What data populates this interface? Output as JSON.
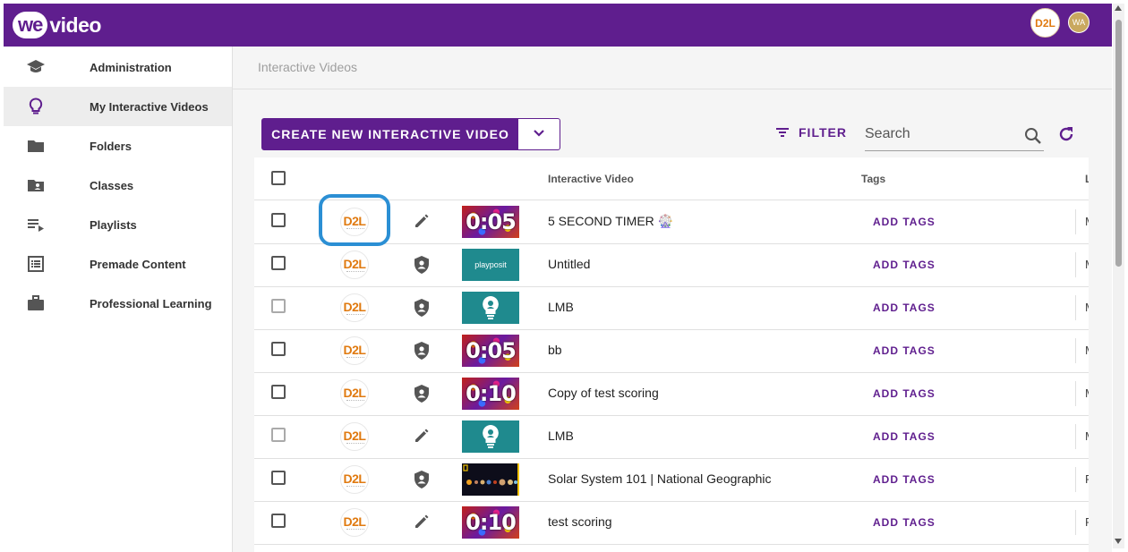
{
  "app": {
    "logo_we": "we",
    "logo_video": "video",
    "org_badge": "D2L",
    "user_initials": "WA",
    "brand_color": "#5f1e8e"
  },
  "sidebar": {
    "items": [
      {
        "label": "Administration",
        "icon": "graduation-cap-icon",
        "active": false
      },
      {
        "label": "My Interactive Videos",
        "icon": "lightbulb-icon",
        "active": true
      },
      {
        "label": "Folders",
        "icon": "folder-icon",
        "active": false
      },
      {
        "label": "Classes",
        "icon": "class-folder-icon",
        "active": false
      },
      {
        "label": "Playlists",
        "icon": "playlist-icon",
        "active": false
      },
      {
        "label": "Premade Content",
        "icon": "list-document-icon",
        "active": false
      },
      {
        "label": "Professional Learning",
        "icon": "briefcase-icon",
        "active": false
      }
    ]
  },
  "breadcrumb": "Interactive Videos",
  "toolbar": {
    "create_label": "CREATE NEW INTERACTIVE VIDEO",
    "filter_label": "FILTER",
    "search_placeholder": "Search"
  },
  "table": {
    "headers": {
      "video": "Interactive Video",
      "tags": "Tags",
      "last": "L"
    },
    "rows": [
      {
        "owner": "D2L",
        "action_icon": "pencil-icon",
        "thumb": "timer",
        "thumb_text": "0:05",
        "title": "5 SECOND TIMER 🎡",
        "tags": "ADD TAGS",
        "last": "M"
      },
      {
        "owner": "D2L",
        "action_icon": "shield-user-icon",
        "thumb": "playposit",
        "thumb_text": "playposit",
        "title": "Untitled",
        "tags": "ADD TAGS",
        "last": "M"
      },
      {
        "owner": "D2L",
        "action_icon": "shield-user-icon",
        "thumb": "bulb",
        "thumb_text": "",
        "title": "LMB",
        "tags": "ADD TAGS",
        "last": "M"
      },
      {
        "owner": "D2L",
        "action_icon": "shield-user-icon",
        "thumb": "timer",
        "thumb_text": "0:05",
        "title": "bb",
        "tags": "ADD TAGS",
        "last": "M"
      },
      {
        "owner": "D2L",
        "action_icon": "shield-user-icon",
        "thumb": "timer",
        "thumb_text": "0:10",
        "title": "Copy of test scoring",
        "tags": "ADD TAGS",
        "last": "M"
      },
      {
        "owner": "D2L",
        "action_icon": "pencil-icon",
        "thumb": "bulb",
        "thumb_text": "",
        "title": "LMB",
        "tags": "ADD TAGS",
        "last": "M"
      },
      {
        "owner": "D2L",
        "action_icon": "shield-user-icon",
        "thumb": "solar",
        "thumb_text": "",
        "title": "Solar System 101 | National Geographic",
        "tags": "ADD TAGS",
        "last": "F"
      },
      {
        "owner": "D2L",
        "action_icon": "pencil-icon",
        "thumb": "timer",
        "thumb_text": "0:10",
        "title": "test scoring",
        "tags": "ADD TAGS",
        "last": "F"
      }
    ]
  }
}
